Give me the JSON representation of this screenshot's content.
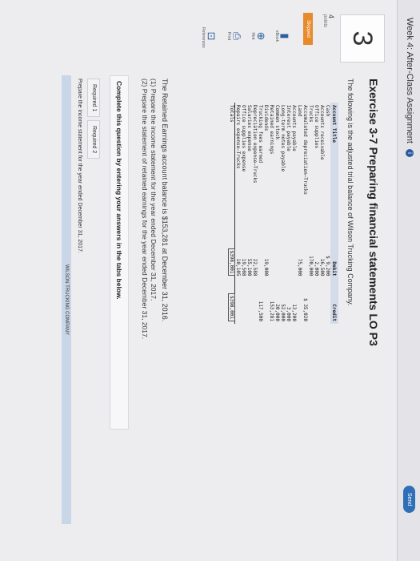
{
  "header": {
    "assignment_title": "Week 4: After-Class Assignment",
    "info_icon": "i",
    "send_label": "Send"
  },
  "question": {
    "number": "3",
    "points_value": "4",
    "points_label": "points",
    "status": "Skipped"
  },
  "side_tools": [
    {
      "icon": "book-icon",
      "glyph": "▮",
      "label": "eBook"
    },
    {
      "icon": "hint-icon",
      "glyph": "⊕",
      "label": "Hint"
    },
    {
      "icon": "print-icon",
      "glyph": "⎙",
      "label": "Print"
    },
    {
      "icon": "references-icon",
      "glyph": "⊡",
      "label": "References"
    }
  ],
  "exercise": {
    "title": "Exercise 3-7 Preparing financial statements LO P3",
    "intro": "The following is the adjusted trial balance of Wilson Trucking Company.",
    "table": {
      "headers": [
        "Account Title",
        "Debit",
        "Credit"
      ],
      "rows": [
        [
          "Cash",
          "$ 9,200",
          ""
        ],
        [
          "Accounts receivable",
          "16,500",
          ""
        ],
        [
          "Office supplies",
          "2,000",
          ""
        ],
        [
          "Trucks",
          "170,000",
          ""
        ],
        [
          "Accumulated depreciation–Trucks",
          "",
          "$ 35,020"
        ],
        [
          "Land",
          "75,000",
          ""
        ],
        [
          "Accounts payable",
          "",
          "13,200"
        ],
        [
          "Interest payable",
          "",
          "3,000"
        ],
        [
          "Long-term notes payable",
          "",
          "52,000"
        ],
        [
          "Common stock",
          "",
          "20,000"
        ],
        [
          "Retained earnings",
          "",
          "153,281"
        ],
        [
          "Dividends",
          "19,000",
          ""
        ],
        [
          "Trucking fees earned",
          "",
          "117,500"
        ],
        [
          "Depreciation expense–Trucks",
          "22,588",
          ""
        ],
        [
          "Salaries expense",
          "55,100",
          ""
        ],
        [
          "Office supplies expense",
          "19,508",
          ""
        ],
        [
          "Repairs expense–Trucks",
          "10,105",
          ""
        ]
      ],
      "total": [
        "Totals",
        "$398,001",
        "$398,001"
      ]
    },
    "re_note": "The Retained Earnings account balance is $153,281 at December 31, 2016.",
    "requirements": [
      "(1) Prepare the income statement for the year ended December 31, 2017.",
      "(2) Prepare the statement of retained earnings for the year ended December 31, 2017."
    ],
    "complete_prompt": "Complete this question by entering your answers in the tabs below.",
    "tabs": [
      "Required 1",
      "Required 2"
    ],
    "prepare_text": "Prepare the income statement for the year ended December 31, 2017.",
    "company_bar": "WILSON TRUCKING COMPANY"
  }
}
